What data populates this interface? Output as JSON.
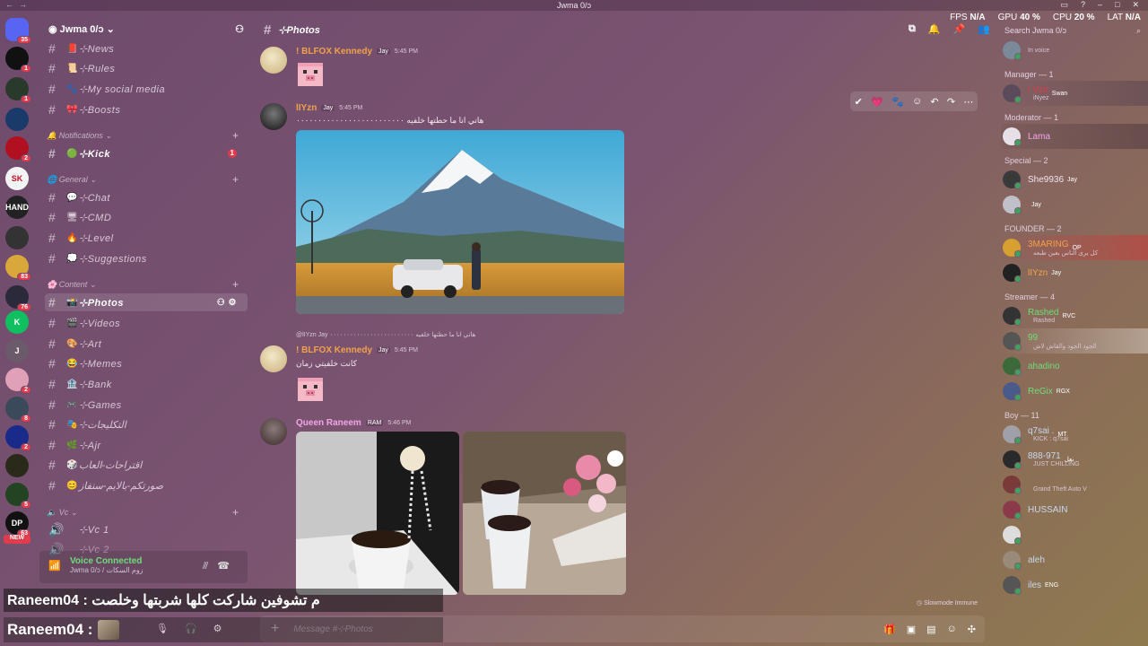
{
  "window": {
    "title": "Jwma 0/ɔ"
  },
  "stats": {
    "fps_label": "FPS",
    "fps": "N/A",
    "gpu_label": "GPU",
    "gpu": "40 %",
    "cpu_label": "CPU",
    "cpu": "20 %",
    "lat_label": "LAT",
    "lat": "N/A"
  },
  "search": {
    "placeholder": "Search Jwma 0/ɔ"
  },
  "servers": [
    {
      "badge": "35"
    },
    {
      "badge": "1"
    },
    {
      "badge": "1"
    },
    {
      "badge": ""
    },
    {
      "badge": "2"
    },
    {
      "label": "SK",
      "badge": ""
    },
    {
      "label": "HAND",
      "badge": ""
    },
    {
      "badge": ""
    },
    {
      "badge": "83"
    },
    {
      "badge": "76"
    },
    {
      "label": "K",
      "badge": ""
    },
    {
      "label": "J",
      "badge": ""
    },
    {
      "badge": "2"
    },
    {
      "badge": "8"
    },
    {
      "badge": "2"
    },
    {
      "badge": ""
    },
    {
      "badge": "5"
    },
    {
      "label": "DP",
      "badge": "63"
    }
  ],
  "new_tag": "NEW",
  "guild": {
    "name": "Jwma 0/ɔ"
  },
  "channels": {
    "top": [
      {
        "emoji": "📕",
        "name": "⊹News"
      },
      {
        "emoji": "📜",
        "name": "⊹Rules"
      },
      {
        "emoji": "🐾",
        "name": "⊹My social media"
      },
      {
        "emoji": "🎀",
        "name": "⊹Boosts"
      }
    ],
    "cat_notifications": "Notifications",
    "kick": {
      "emoji": "🟢",
      "name": "⊹Kick",
      "badge": "1"
    },
    "cat_general": "General",
    "general": [
      {
        "emoji": "💬",
        "name": "⊹Chat"
      },
      {
        "emoji": "🖥",
        "name": "⊹CMD"
      },
      {
        "emoji": "🔥",
        "name": "⊹Level"
      },
      {
        "emoji": "💭",
        "name": "⊹Suggestions"
      }
    ],
    "cat_content": "Content",
    "content": [
      {
        "emoji": "📸",
        "name": "⊹Photos"
      },
      {
        "emoji": "🎬",
        "name": "⊹Videos"
      },
      {
        "emoji": "🎨",
        "name": "⊹Art"
      },
      {
        "emoji": "😂",
        "name": "⊹Memes"
      },
      {
        "emoji": "🏦",
        "name": "⊹Bank"
      },
      {
        "emoji": "🎮",
        "name": "⊹Games"
      },
      {
        "emoji": "🎭",
        "name": "⊹التكليجات"
      },
      {
        "emoji": "🌿",
        "name": "⊹Ajr"
      },
      {
        "emoji": "🎲",
        "name": "اقتراحات-العاب"
      },
      {
        "emoji": "😊",
        "name": "صورتكم-بالايم-سنفاز"
      }
    ],
    "cat_vc": "Vc",
    "vc": [
      {
        "emoji": "🔊",
        "name": "⊹Vc 1"
      },
      {
        "emoji": "🔊",
        "name": "⊹Vc 2"
      }
    ]
  },
  "voice": {
    "title": "Voice Connected",
    "sub": "Jwma 0/ɔ / زوم السكات"
  },
  "chat": {
    "channel": "⊹Photos",
    "messages": [
      {
        "user": "! BLFOX Kennedy",
        "tag": "Jay",
        "time": "5:45 PM"
      },
      {
        "user": "lIYzn",
        "tag": "Jay",
        "time": "5:45 PM",
        "text": "هاتي انا ما حطتها خلفيه ٠٠٠٠٠٠٠٠٠٠٠٠٠٠٠٠٠٠٠٠٠٠٠٠٠"
      },
      {
        "user": "! BLFOX Kennedy",
        "tag": "Jay",
        "time": "5:45 PM",
        "text": "كانت خلفيتي زمان"
      },
      {
        "user": "Queen Raneem",
        "tag": "RAM",
        "time": "5:46 PM"
      }
    ],
    "reply_ref": "@lIYzn  Jay  هاتي انا ما حطتها خلفيه ٠٠٠٠٠٠٠٠٠٠٠٠٠٠٠٠٠٠٠٠٠٠٠٠٠",
    "slowmode": "Slowmode Immune",
    "composer_placeholder": "Message #⊹Photos"
  },
  "overlay": {
    "line1": "Raneem04 : م تشوفين شاركت كلها شربتها وخلصت",
    "line2": "Raneem04 :"
  },
  "members": {
    "in_voice": "In voice",
    "roles": [
      {
        "name": "Manager — 1",
        "members": [
          {
            "name": "! Vzn",
            "tag": "Swan",
            "status": "iNyez",
            "color": "#e03c4c"
          }
        ]
      },
      {
        "name": "Moderator — 1",
        "members": [
          {
            "name": "Lama",
            "tag": "",
            "status": "",
            "color": "#f3a6e8"
          }
        ]
      },
      {
        "name": "Special — 2",
        "members": [
          {
            "name": "She9936",
            "tag": "Jay",
            "status": "",
            "color": "#f0e4ee"
          },
          {
            "name": "",
            "tag": "Jay",
            "status": "",
            "color": "#f0e4ee"
          }
        ]
      },
      {
        "name": "FOUNDER — 2",
        "members": [
          {
            "name": "3MARING",
            "tag": "OP",
            "status": "كل يرى الناس بعين طبعه",
            "color": "#f2a24a"
          },
          {
            "name": "lIYzn",
            "tag": "Jay",
            "status": "",
            "color": "#f2a24a"
          }
        ]
      },
      {
        "name": "Streamer — 4",
        "members": [
          {
            "name": "Rashed",
            "tag": "RVC",
            "status": "Rashed",
            "color": "#6fdc7b"
          },
          {
            "name": "99",
            "tag": "",
            "status": "الجود الجود والقاش لاش",
            "color": "#6fdc7b"
          },
          {
            "name": "ahadino",
            "tag": "",
            "status": "",
            "color": "#6fdc7b"
          },
          {
            "name": "ReGix",
            "tag": "RGX",
            "status": "",
            "color": "#6fdc7b"
          }
        ]
      },
      {
        "name": "Boy — 11",
        "members": [
          {
            "name": "q7sai .",
            "tag": "MT",
            "status": "KICK : q7sai",
            "color": "#c8d8f0"
          },
          {
            "name": "888-971",
            "tag": "نعل",
            "status": "JUST CHILLING",
            "color": "#c8d8f0"
          },
          {
            "name": "",
            "tag": "",
            "status": "Grand Theft Auto V",
            "color": "#c8d8f0"
          },
          {
            "name": "HUSSAIN",
            "tag": "",
            "status": "",
            "color": "#c8d8f0"
          },
          {
            "name": "",
            "tag": "",
            "status": "",
            "color": "#c8d8f0"
          },
          {
            "name": "aleh",
            "tag": "",
            "status": "",
            "color": "#c8d8f0"
          },
          {
            "name": "iles",
            "tag": "ENG",
            "status": "",
            "color": "#c8d8f0"
          }
        ]
      }
    ]
  }
}
